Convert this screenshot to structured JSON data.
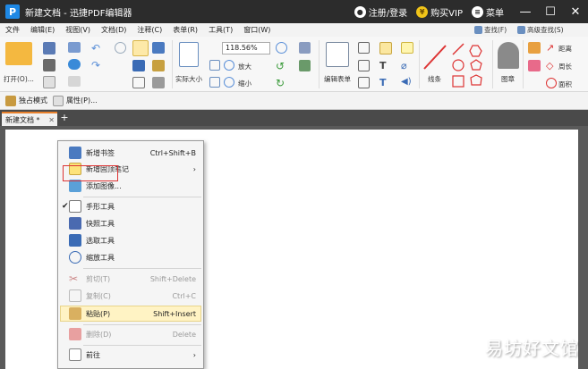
{
  "window": {
    "title": "新建文档 - 迅捷PDF编辑器",
    "logo_letter": "P"
  },
  "titlebar_right": {
    "login": "注册/登录",
    "vip": "购买VIP",
    "menu": "菜单",
    "minimize": "—",
    "maximize": "☐",
    "close": "✕"
  },
  "menubar": [
    "文件",
    "编辑(E)",
    "视图(V)",
    "文档(D)",
    "注释(C)",
    "表单(R)",
    "工具(T)",
    "窗口(W)"
  ],
  "toolbar": {
    "open_label": "打开(O)...",
    "zoom_value": "118.56%",
    "fit_actual": "实际大小",
    "zoom_in": "放大",
    "zoom_out": "缩小",
    "edit_form": "编辑表单",
    "lines": "线条",
    "stamp": "图章",
    "find": "查找(F)",
    "advanced_find": "高级查找(S)",
    "distance": "距离",
    "perimeter": "周长",
    "area": "面积"
  },
  "subbar": {
    "exclusive_mode": "独占模式",
    "properties": "属性(P)..."
  },
  "tabs": [
    {
      "label": "新建文档 *"
    }
  ],
  "context_menu": {
    "items": [
      {
        "label": "新增书签",
        "shortcut": "Ctrl+Shift+B",
        "arrow": "",
        "check": "",
        "disabled": false
      },
      {
        "label": "新增固顶笔记",
        "shortcut": "",
        "arrow": "›",
        "check": "",
        "disabled": false
      },
      {
        "label": "添加图像...",
        "shortcut": "",
        "arrow": "",
        "check": "",
        "disabled": false
      },
      {
        "label": "手形工具",
        "shortcut": "",
        "arrow": "",
        "check": "✔",
        "disabled": false
      },
      {
        "label": "快照工具",
        "shortcut": "",
        "arrow": "",
        "check": "",
        "disabled": false
      },
      {
        "label": "选取工具",
        "shortcut": "",
        "arrow": "",
        "check": "",
        "disabled": false
      },
      {
        "label": "缩放工具",
        "shortcut": "",
        "arrow": "",
        "check": "",
        "disabled": false
      },
      {
        "label": "剪切(T)",
        "shortcut": "Shift+Delete",
        "arrow": "",
        "check": "",
        "disabled": true
      },
      {
        "label": "复制(C)",
        "shortcut": "Ctrl+C",
        "arrow": "",
        "check": "",
        "disabled": true
      },
      {
        "label": "粘贴(P)",
        "shortcut": "Shift+Insert",
        "arrow": "",
        "check": "",
        "disabled": false
      },
      {
        "label": "删除(D)",
        "shortcut": "Delete",
        "arrow": "",
        "check": "",
        "disabled": true
      },
      {
        "label": "前往",
        "shortcut": "",
        "arrow": "›",
        "check": "",
        "disabled": false
      }
    ]
  },
  "watermark": "易坊好文馆",
  "colors": {
    "titlebar": "#2c2c2c",
    "accent_orange": "#e8802c",
    "highlight_box": "#dd3333",
    "paste_highlight": "#fff3c4"
  }
}
